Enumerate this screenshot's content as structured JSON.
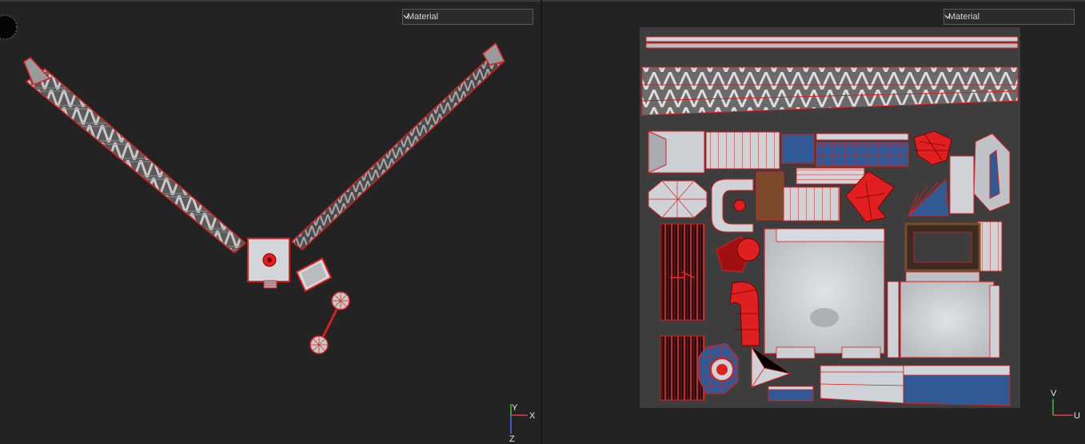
{
  "left_viewport": {
    "shading_mode": "Material",
    "axes": {
      "x": "X",
      "y": "Y",
      "z": "Z"
    }
  },
  "right_viewport": {
    "shading_mode": "Material",
    "axes": {
      "u": "U",
      "v": "V"
    }
  },
  "colors": {
    "background": "#232323",
    "selection_edge": "#d62020",
    "uv_canvas": "#3c3c3c",
    "surface_grey": "#c8ccd0",
    "accent_blue": "#2f5a96"
  }
}
